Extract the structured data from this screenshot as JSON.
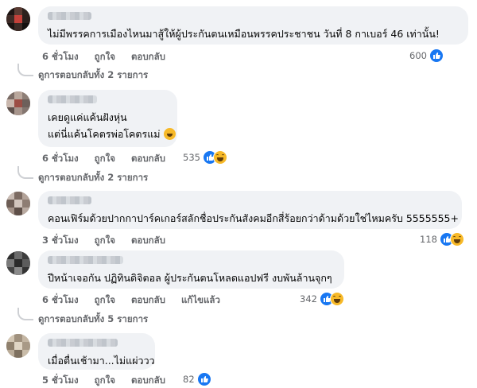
{
  "comments": [
    {
      "text": "ไม่มีพรรคการเมืองไหนมาสู้ให้ผู้ประกันตนเหมือนพรรคประชาชน วันที่ 8 กาเบอร์ 46 เท่านั้น!",
      "time": "6 ชั่วโมง",
      "like": "ถูกใจ",
      "reply": "ตอบกลับ",
      "reaction_count": "600",
      "reactions": [
        "like-icon"
      ],
      "view_replies": "ดูการตอบกลับทั้ง 2 รายการ"
    },
    {
      "line1": "เคยดูแค่แค้นฝังหุ่น",
      "line2": "แต่นี่แค้นโคตรพ่อโคตรแม่",
      "time": "6 ชั่วโมง",
      "like": "ถูกใจ",
      "reply": "ตอบกลับ",
      "reaction_count": "535",
      "reactions": [
        "like-icon",
        "haha-icon"
      ],
      "view_replies": "ดูการตอบกลับทั้ง 2 รายการ"
    },
    {
      "text": "คอนเฟิร์มด้วยปากกาปาร์คเกอร์สลักชื่อประกันสังคมอีกสี่ร้อยกว่าด้ามด้วยใช่ไหมครับ 5555555+",
      "time": "3 ชั่วโมง",
      "like": "ถูกใจ",
      "reply": "ตอบกลับ",
      "reaction_count": "118",
      "reactions": [
        "like-icon",
        "haha-icon"
      ]
    },
    {
      "text": "ปีหน้าเจอกัน ปฏิทินดิจิตอล ผู้ประกันตนโหลดแอปฟรี งบพันล้านจุกๆ",
      "time": "6 ชั่วโมง",
      "like": "ถูกใจ",
      "reply": "ตอบกลับ",
      "edited": "แก้ไขแล้ว",
      "reaction_count": "342",
      "reactions": [
        "like-icon",
        "haha-icon"
      ],
      "view_replies": "ดูการตอบกลับทั้ง 5 รายการ"
    },
    {
      "text": "เมื่อตื่นเช้ามา...ไม่แผ่ววว",
      "time": "5 ชั่วโมง",
      "like": "ถูกใจ",
      "reply": "ตอบกลับ",
      "reaction_count": "82",
      "reactions": [
        "like-icon"
      ]
    }
  ],
  "colors": {
    "bubble": "#f0f2f5",
    "meta_text": "#65676b",
    "like_blue": "#1877f2",
    "haha_yellow": "#f7b928"
  }
}
